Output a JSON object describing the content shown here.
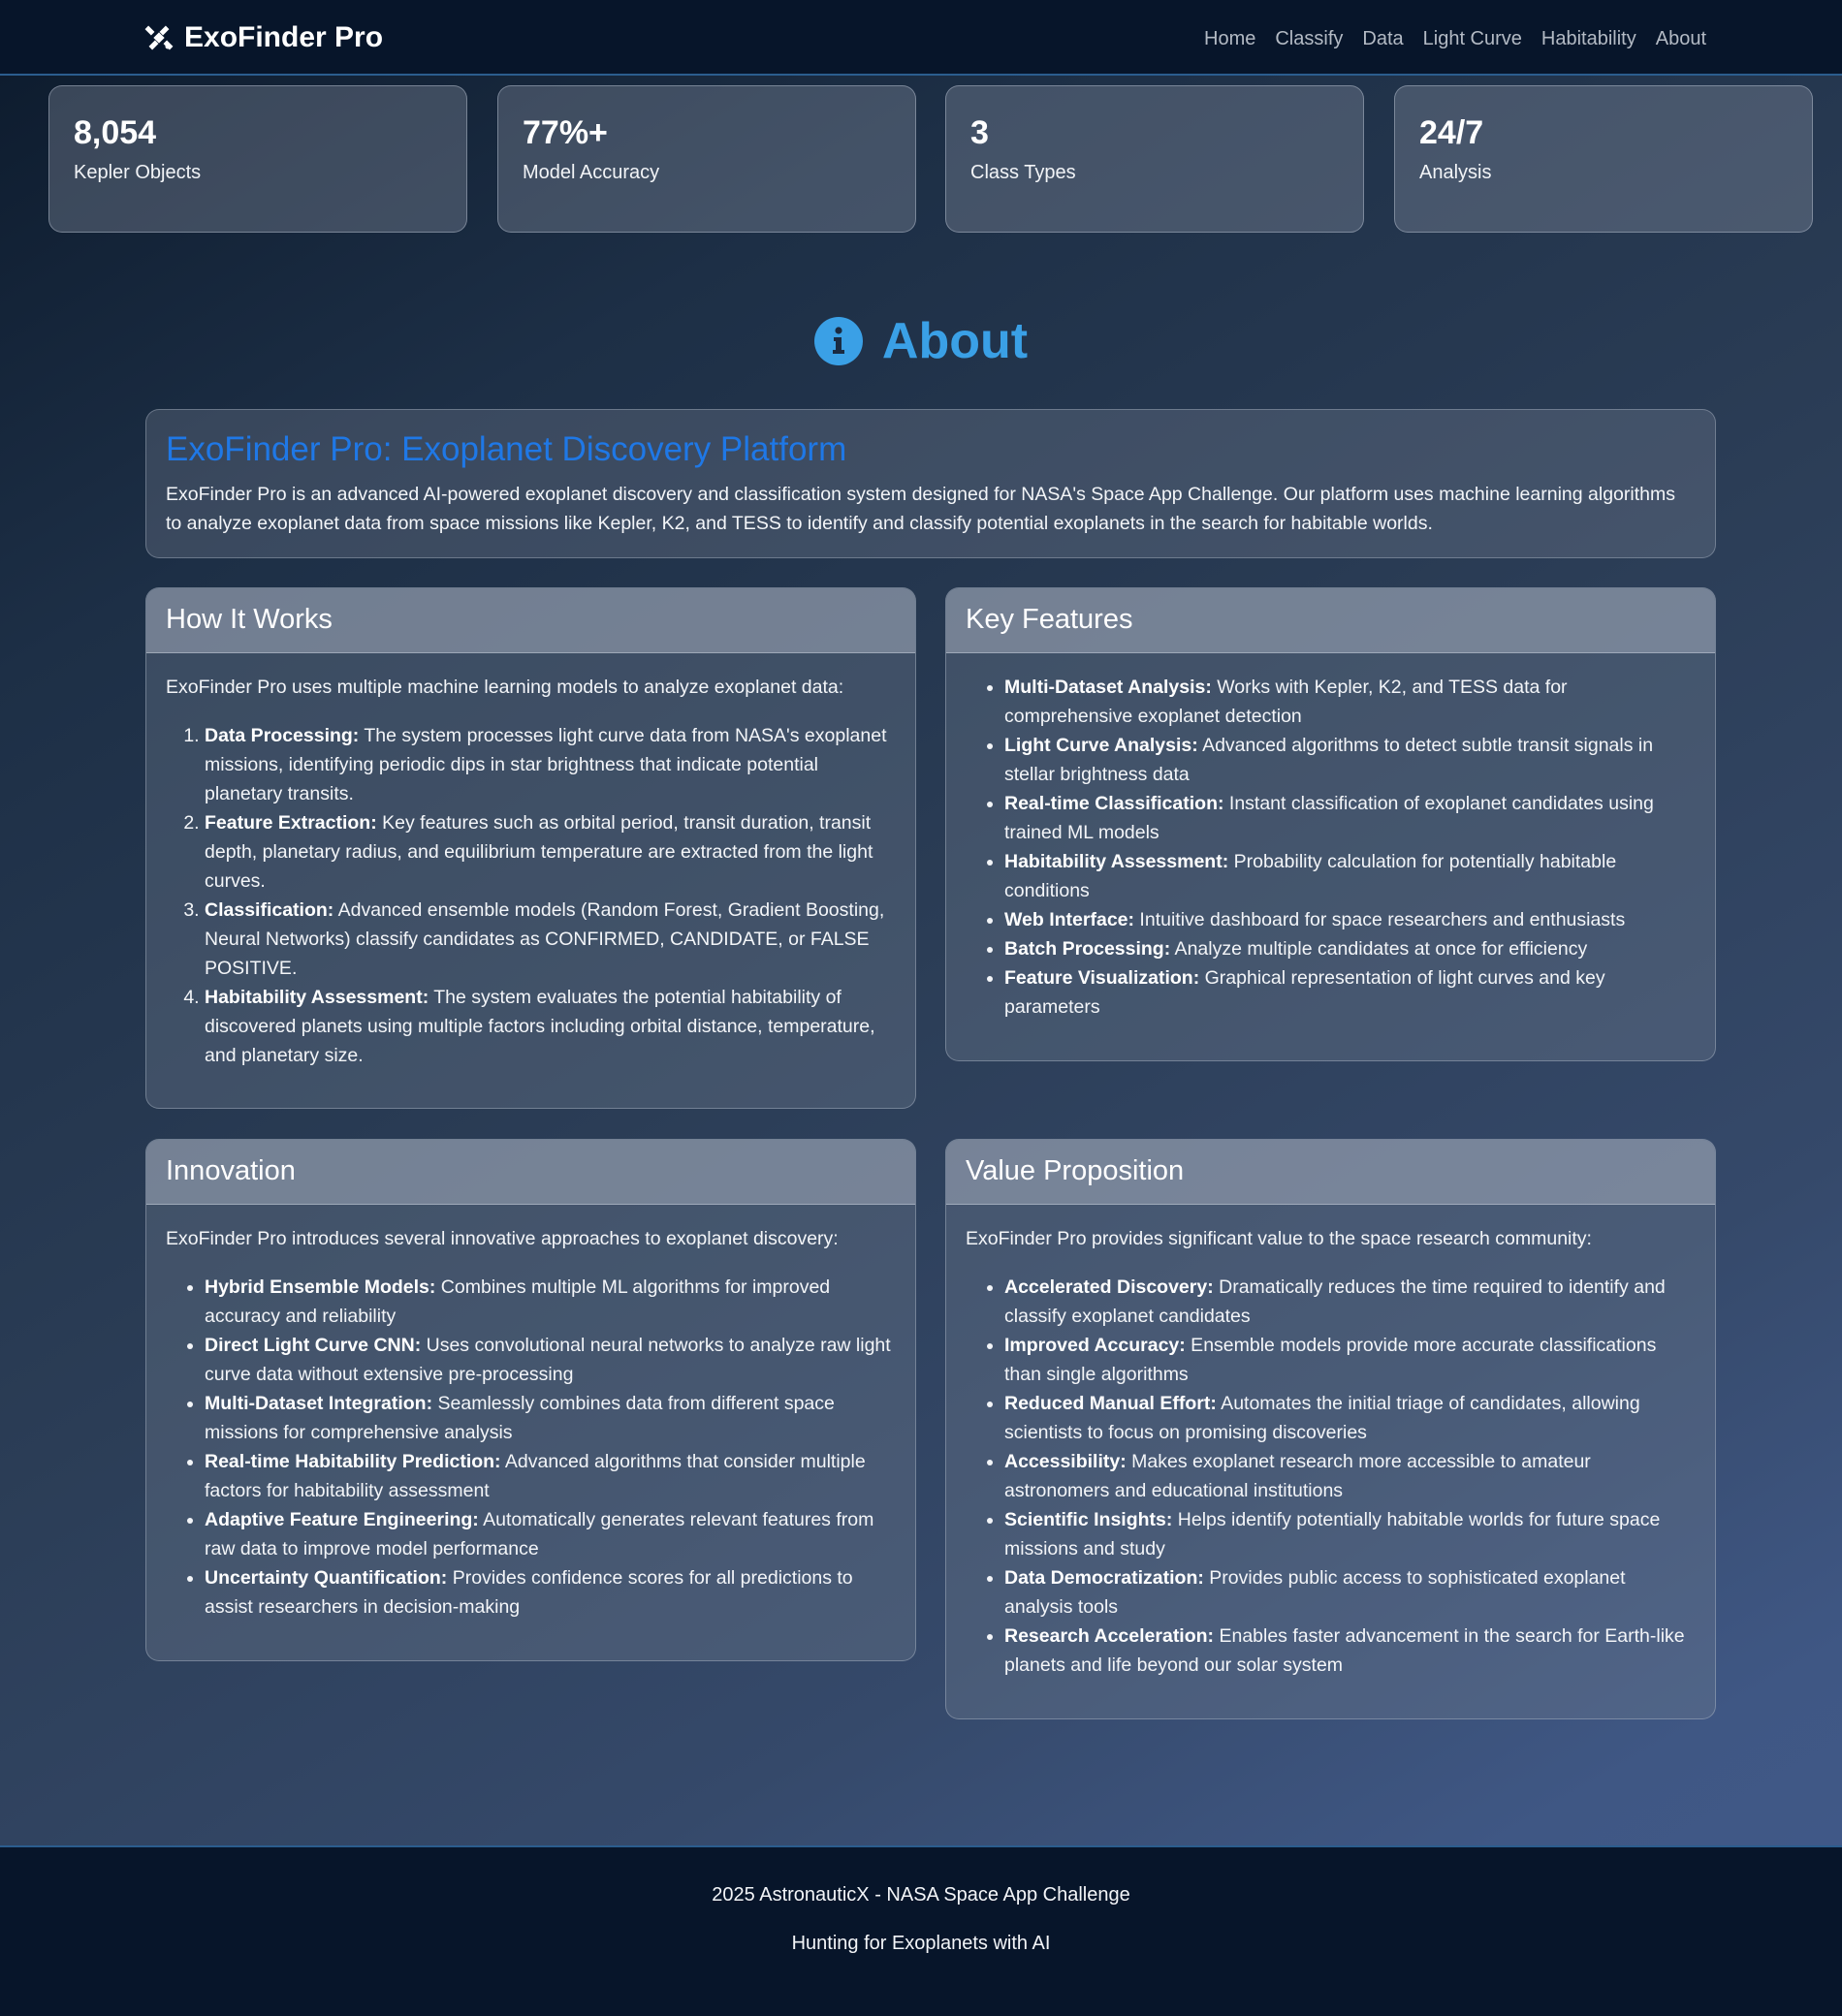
{
  "nav": {
    "brand": "ExoFinder Pro",
    "brand_icon": "satellite-icon",
    "links": [
      "Home",
      "Classify",
      "Data",
      "Light Curve",
      "Habitability",
      "About"
    ]
  },
  "stats": [
    {
      "value": "8,054",
      "label": "Kepler Objects"
    },
    {
      "value": "77%+",
      "label": "Model Accuracy"
    },
    {
      "value": "3",
      "label": "Class Types"
    },
    {
      "value": "24/7",
      "label": "Analysis"
    }
  ],
  "about": {
    "title": "About",
    "icon": "info-circle-icon",
    "title_color": "#3aa0e6"
  },
  "intro": {
    "heading": "ExoFinder Pro: Exoplanet Discovery Platform",
    "body": "ExoFinder Pro is an advanced AI-powered exoplanet discovery and classification system designed for NASA's Space App Challenge. Our platform uses machine learning algorithms to analyze exoplanet data from space missions like Kepler, K2, and TESS to identify and classify potential exoplanets in the search for habitable worlds."
  },
  "how_it_works": {
    "title": "How It Works",
    "intro": "ExoFinder Pro uses multiple machine learning models to analyze exoplanet data:",
    "items": [
      {
        "label": "Data Processing:",
        "text": " The system processes light curve data from NASA's exoplanet missions, identifying periodic dips in star brightness that indicate potential planetary transits."
      },
      {
        "label": "Feature Extraction:",
        "text": " Key features such as orbital period, transit duration, transit depth, planetary radius, and equilibrium temperature are extracted from the light curves."
      },
      {
        "label": "Classification:",
        "text": " Advanced ensemble models (Random Forest, Gradient Boosting, Neural Networks) classify candidates as CONFIRMED, CANDIDATE, or FALSE POSITIVE."
      },
      {
        "label": "Habitability Assessment:",
        "text": " The system evaluates the potential habitability of discovered planets using multiple factors including orbital distance, temperature, and planetary size."
      }
    ]
  },
  "key_features": {
    "title": "Key Features",
    "items": [
      {
        "label": "Multi-Dataset Analysis:",
        "text": " Works with Kepler, K2, and TESS data for comprehensive exoplanet detection"
      },
      {
        "label": "Light Curve Analysis:",
        "text": " Advanced algorithms to detect subtle transit signals in stellar brightness data"
      },
      {
        "label": "Real-time Classification:",
        "text": " Instant classification of exoplanet candidates using trained ML models"
      },
      {
        "label": "Habitability Assessment:",
        "text": " Probability calculation for potentially habitable conditions"
      },
      {
        "label": "Web Interface:",
        "text": " Intuitive dashboard for space researchers and enthusiasts"
      },
      {
        "label": "Batch Processing:",
        "text": " Analyze multiple candidates at once for efficiency"
      },
      {
        "label": "Feature Visualization:",
        "text": " Graphical representation of light curves and key parameters"
      }
    ]
  },
  "innovation": {
    "title": "Innovation",
    "intro": "ExoFinder Pro introduces several innovative approaches to exoplanet discovery:",
    "items": [
      {
        "label": "Hybrid Ensemble Models:",
        "text": " Combines multiple ML algorithms for improved accuracy and reliability"
      },
      {
        "label": "Direct Light Curve CNN:",
        "text": " Uses convolutional neural networks to analyze raw light curve data without extensive pre-processing"
      },
      {
        "label": "Multi-Dataset Integration:",
        "text": " Seamlessly combines data from different space missions for comprehensive analysis"
      },
      {
        "label": "Real-time Habitability Prediction:",
        "text": " Advanced algorithms that consider multiple factors for habitability assessment"
      },
      {
        "label": "Adaptive Feature Engineering:",
        "text": " Automatically generates relevant features from raw data to improve model performance"
      },
      {
        "label": "Uncertainty Quantification:",
        "text": " Provides confidence scores for all predictions to assist researchers in decision-making"
      }
    ]
  },
  "value_proposition": {
    "title": "Value Proposition",
    "intro": "ExoFinder Pro provides significant value to the space research community:",
    "items": [
      {
        "label": "Accelerated Discovery:",
        "text": " Dramatically reduces the time required to identify and classify exoplanet candidates"
      },
      {
        "label": "Improved Accuracy:",
        "text": " Ensemble models provide more accurate classifications than single algorithms"
      },
      {
        "label": "Reduced Manual Effort:",
        "text": " Automates the initial triage of candidates, allowing scientists to focus on promising discoveries"
      },
      {
        "label": "Accessibility:",
        "text": " Makes exoplanet research more accessible to amateur astronomers and educational institutions"
      },
      {
        "label": "Scientific Insights:",
        "text": " Helps identify potentially habitable worlds for future space missions and study"
      },
      {
        "label": "Data Democratization:",
        "text": " Provides public access to sophisticated exoplanet analysis tools"
      },
      {
        "label": "Research Acceleration:",
        "text": " Enables faster advancement in the search for Earth-like planets and life beyond our solar system"
      }
    ]
  },
  "footer": {
    "line1": "2025 AstronauticX - NASA Space App Challenge",
    "line2": "Hunting for Exoplanets with AI"
  }
}
